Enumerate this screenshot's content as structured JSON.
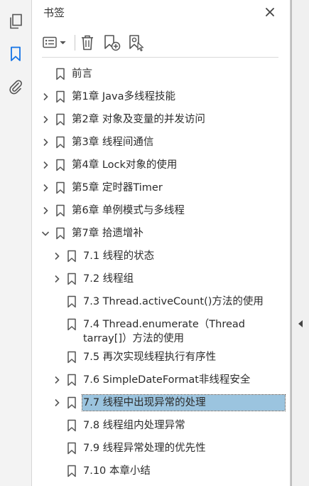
{
  "panel": {
    "title": "书签"
  },
  "rail": {
    "icons": [
      "pages-icon",
      "bookmark-icon",
      "attachment-icon"
    ],
    "active": "bookmark-icon",
    "accent": "#1473e6"
  },
  "toolbar": {
    "icons": [
      "options-menu-icon",
      "delete-bookmark-icon",
      "new-bookmark-icon",
      "new-bookmark-from-structure-icon"
    ]
  },
  "colors": {
    "selection": "#9bc4df",
    "icon": "#555555"
  },
  "bookmarks": [
    {
      "label": "前言",
      "level": 0,
      "expander": "none"
    },
    {
      "label": "第1章 Java多线程技能",
      "level": 0,
      "expander": "collapsed"
    },
    {
      "label": "第2章 对象及变量的并发访问",
      "level": 0,
      "expander": "collapsed"
    },
    {
      "label": "第3章 线程间通信",
      "level": 0,
      "expander": "collapsed"
    },
    {
      "label": "第4章 Lock对象的使用",
      "level": 0,
      "expander": "collapsed"
    },
    {
      "label": "第5章 定时器Timer",
      "level": 0,
      "expander": "collapsed"
    },
    {
      "label": "第6章 单例模式与多线程",
      "level": 0,
      "expander": "collapsed"
    },
    {
      "label": "第7章 拾遗增补",
      "level": 0,
      "expander": "expanded"
    },
    {
      "label": "7.1 线程的状态",
      "level": 1,
      "expander": "collapsed"
    },
    {
      "label": "7.2 线程组",
      "level": 1,
      "expander": "collapsed"
    },
    {
      "label": "7.3 Thread.activeCount()方法的使用",
      "level": 1,
      "expander": "none"
    },
    {
      "label": "7.4 Thread.enumerate（Thread tarray[]）方法的使用",
      "level": 1,
      "expander": "none",
      "wrap": true
    },
    {
      "label": "7.5 再次实现线程执行有序性",
      "level": 1,
      "expander": "none"
    },
    {
      "label": "7.6 SimpleDateFormat非线程安全",
      "level": 1,
      "expander": "collapsed"
    },
    {
      "label": "7.7 线程中出现异常的处理",
      "level": 1,
      "expander": "collapsed",
      "selected": true
    },
    {
      "label": "7.8 线程组内处理异常",
      "level": 1,
      "expander": "none"
    },
    {
      "label": "7.9 线程异常处理的优先性",
      "level": 1,
      "expander": "none"
    },
    {
      "label": "7.10 本章小结",
      "level": 1,
      "expander": "none"
    }
  ]
}
